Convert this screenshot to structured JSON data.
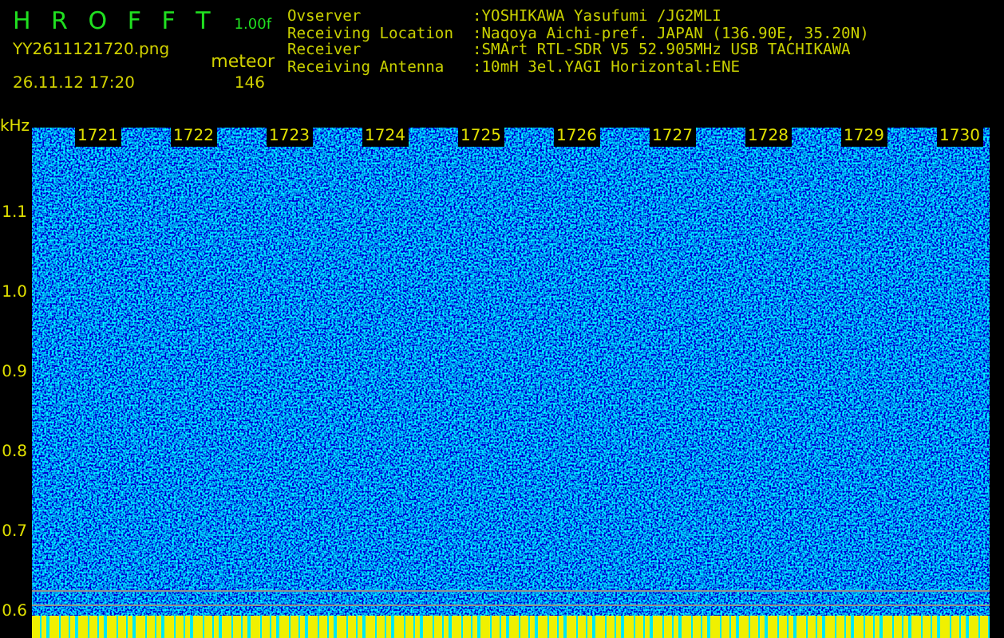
{
  "app": {
    "title": "H R O F F T",
    "version": "1.00f",
    "filename": "YY2611121720.png",
    "mode": "meteor",
    "datetime": "26.11.12 17:20",
    "count": "146"
  },
  "station": [
    {
      "label": "Ovserver",
      "value": ":YOSHIKAWA Yasufumi /JG2MLI"
    },
    {
      "label": "Receiving Location",
      "value": ":Naqoya Aichi-pref. JAPAN (136.90E, 35.20N)"
    },
    {
      "label": "Receiver",
      "value": ":SMArt RTL-SDR V5 52.905MHz USB TACHIKAWA"
    },
    {
      "label": "Receiving Antenna",
      "value": ":10mH 3el.YAGI Horizontal:ENE"
    }
  ],
  "y_axis": {
    "unit": "kHz",
    "ticks": [
      "1.1",
      "1.0",
      "0.9",
      "0.8",
      "0.7",
      "0.6"
    ]
  },
  "time_markers": [
    "1721",
    "1722",
    "1723",
    "1724",
    "1725",
    "1726",
    "1727",
    "1728",
    "1729",
    "1730"
  ]
}
